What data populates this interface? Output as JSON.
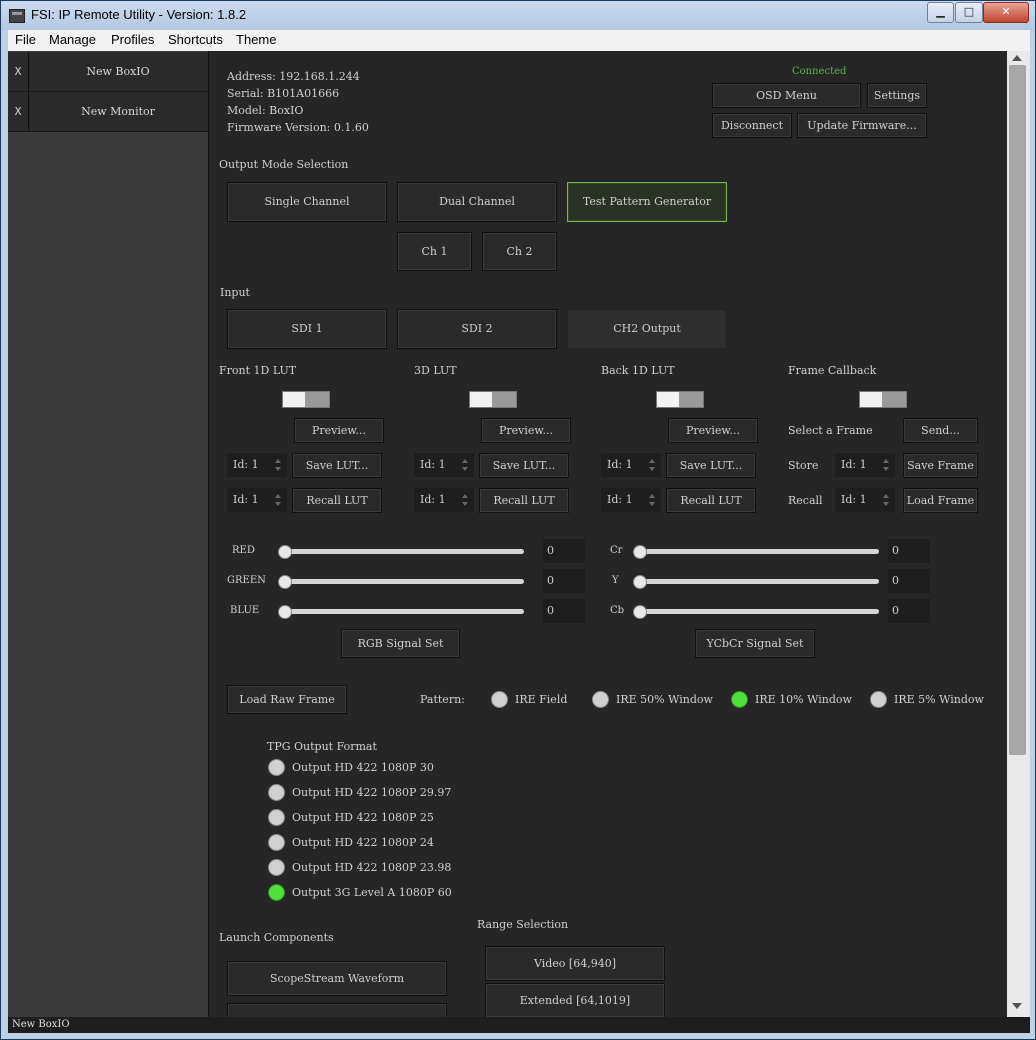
{
  "window": {
    "title": "FSI: IP Remote Utility - Version: 1.8.2"
  },
  "menu": [
    "File",
    "Manage",
    "Profiles",
    "Shortcuts",
    "Theme"
  ],
  "sidebar": {
    "items": [
      {
        "close": "X",
        "label": "New BoxIO"
      },
      {
        "close": "X",
        "label": "New Monitor"
      }
    ]
  },
  "device": {
    "address": "Address: 192.168.1.244",
    "serial": "Serial: B101A01666",
    "model": "Model: BoxIO",
    "firmware": "Firmware Version: 0.1.60",
    "status": "Connected",
    "status_color": "#5fb24a"
  },
  "top_buttons": {
    "osd": "OSD Menu",
    "settings": "Settings",
    "disconnect": "Disconnect",
    "update": "Update Firmware..."
  },
  "output_mode": {
    "label": "Output Mode Selection",
    "single": "Single Channel",
    "dual": "Dual Channel",
    "tpg": "Test Pattern Generator",
    "ch1": "Ch 1",
    "ch2": "Ch 2"
  },
  "input": {
    "label": "Input",
    "sdi1": "SDI 1",
    "sdi2": "SDI 2",
    "ch2out": "CH2 Output"
  },
  "luts": {
    "front": "Front 1D LUT",
    "lut3d": "3D LUT",
    "back": "Back 1D LUT",
    "frame": "Frame Callback",
    "preview": "Preview...",
    "save_lut": "Save LUT...",
    "recall_lut": "Recall LUT",
    "id_text": "Id: 1",
    "select_frame": "Select a Frame",
    "send": "Send...",
    "store": "Store",
    "save_frame": "Save Frame",
    "recall": "Recall",
    "load_frame": "Load Frame"
  },
  "rgb": {
    "red": "RED",
    "green": "GREEN",
    "blue": "BLUE",
    "red_val": "0",
    "green_val": "0",
    "blue_val": "0",
    "set": "RGB Signal Set"
  },
  "ycbcr": {
    "cr": "Cr",
    "y": "Y",
    "cb": "Cb",
    "cr_val": "0",
    "y_val": "0",
    "cb_val": "0",
    "set": "YCbCr Signal Set"
  },
  "pattern": {
    "load_raw": "Load Raw Frame",
    "label": "Pattern:",
    "options": [
      "IRE Field",
      "IRE 50% Window",
      "IRE 10% Window",
      "IRE 5% Window"
    ],
    "selected": "IRE 10% Window"
  },
  "tpg_format": {
    "label": "TPG Output Format",
    "options": [
      "Output HD 422 1080P 30",
      "Output HD 422 1080P 29.97",
      "Output HD 422 1080P 25",
      "Output HD 422 1080P 24",
      "Output HD 422 1080P 23.98",
      "Output 3G Level A 1080P 60"
    ],
    "selected": "Output 3G Level A 1080P 60"
  },
  "launch": {
    "label": "Launch Components",
    "scopestream": "ScopeStream Waveform"
  },
  "range": {
    "label": "Range Selection",
    "video": "Video [64,940]",
    "extended": "Extended [64,1019]"
  },
  "statusbar": "New BoxIO",
  "colors": {
    "accent_green": "#4fe13a",
    "active_border": "#79b846"
  }
}
